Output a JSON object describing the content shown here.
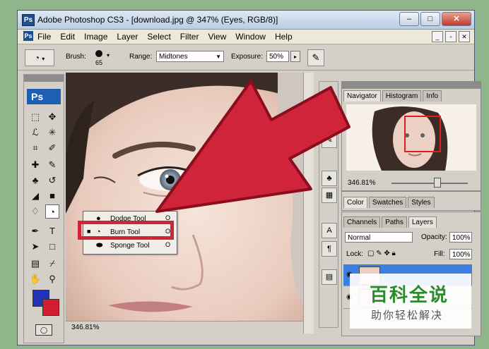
{
  "window": {
    "title": "Adobe Photoshop CS3 - [download.jpg @ 347% (Eyes, RGB/8)]",
    "logo": "Ps"
  },
  "menu": [
    "File",
    "Edit",
    "Image",
    "Layer",
    "Select",
    "Filter",
    "View",
    "Window",
    "Help"
  ],
  "options": {
    "brush_label": "Brush:",
    "brush_size": "65",
    "range_label": "Range:",
    "range_value": "Midtones",
    "exposure_label": "Exposure:",
    "exposure_value": "50%"
  },
  "toolbox": {
    "logo": "Ps"
  },
  "flyout": {
    "items": [
      {
        "label": "Dodge Tool",
        "key": "O"
      },
      {
        "label": "Burn Tool",
        "key": "O"
      },
      {
        "label": "Sponge Tool",
        "key": "O"
      }
    ]
  },
  "canvas": {
    "zoom": "346.81%"
  },
  "navigator": {
    "tabs": [
      "Navigator",
      "Histogram",
      "Info"
    ],
    "zoom": "346.81%"
  },
  "color_panel": {
    "tabs": [
      "Color",
      "Swatches",
      "Styles"
    ]
  },
  "layers": {
    "tabs": [
      "Channels",
      "Paths",
      "Layers"
    ],
    "blend_mode": "Normal",
    "opacity_label": "Opacity:",
    "opacity_value": "100%",
    "lock_label": "Lock:",
    "fill_label": "Fill:",
    "fill_value": "100%"
  },
  "watermark": {
    "title": "百科全说",
    "subtitle": "助你轻松解决"
  },
  "colors": {
    "arrow": "#d0243a",
    "foreground": "#1f32b8",
    "background": "#d41c33",
    "ps_blue": "#1e5fb4"
  },
  "icons": [
    "burn-tool-icon",
    "airbrush-icon",
    "marquee-icon",
    "move-icon",
    "lasso-icon",
    "magic-wand-icon",
    "crop-icon",
    "slice-icon",
    "healing-icon",
    "brush-icon",
    "stamp-icon",
    "history-brush-icon",
    "eraser-icon",
    "gradient-icon",
    "dodge-icon",
    "pen-icon",
    "type-icon",
    "path-select-icon",
    "shape-icon",
    "notes-icon",
    "eyedropper-icon",
    "hand-icon",
    "zoom-icon",
    "quick-mask-icon",
    "eye-icon",
    "sponge-icon"
  ]
}
